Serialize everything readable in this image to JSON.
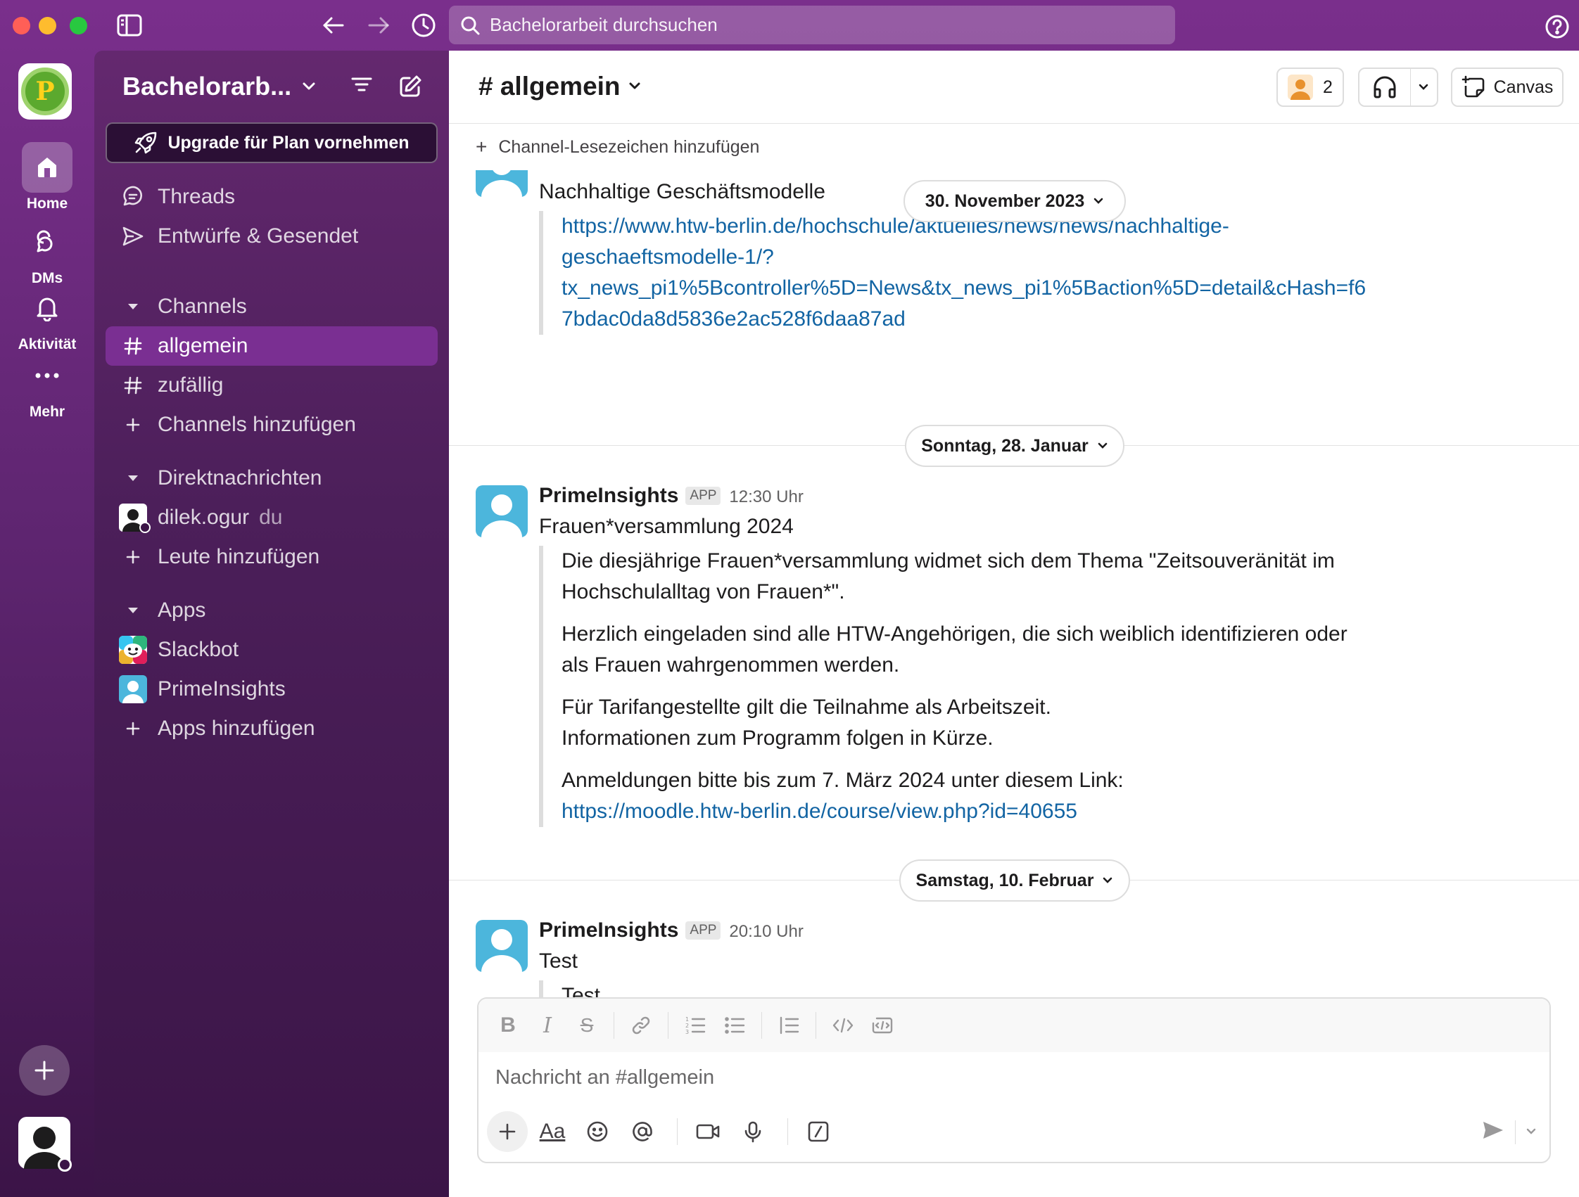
{
  "search": {
    "placeholder": "Bachelorarbeit durchsuchen"
  },
  "rail": {
    "workspace_initial": "P",
    "items": [
      {
        "label": "Home"
      },
      {
        "label": "DMs"
      },
      {
        "label": "Aktivität"
      },
      {
        "label": "Mehr"
      }
    ]
  },
  "sidebar": {
    "workspace_name": "Bachelorarb...",
    "upgrade_label": "Upgrade für Plan vornehmen",
    "nav": [
      {
        "label": "Threads"
      },
      {
        "label": "Entwürfe & Gesendet"
      }
    ],
    "channels_header": "Channels",
    "channels": [
      {
        "label": "allgemein"
      },
      {
        "label": "zufällig"
      }
    ],
    "add_channels": "Channels hinzufügen",
    "dm_header": "Direktnachrichten",
    "dm_user": "dilek.ogur",
    "dm_you": "du",
    "add_people": "Leute hinzufügen",
    "apps_header": "Apps",
    "apps": [
      {
        "label": "Slackbot"
      },
      {
        "label": "PrimeInsights"
      }
    ],
    "add_apps": "Apps hinzufügen"
  },
  "channel": {
    "title": "# allgemein",
    "member_count": "2",
    "canvas_label": "Canvas",
    "bookmark_label": "Channel-Lesezeichen hinzufügen"
  },
  "messages": {
    "msg1": {
      "title": "Nachhaltige Geschäftsmodelle",
      "link_lines": [
        "https://www.htw-berlin.de/hochschule/aktuelles/news/news/nachhaltige-",
        "geschaeftsmodelle-1/?",
        "tx_news_pi1%5Bcontroller%5D=News&tx_news_pi1%5Baction%5D=detail&cHash=f6",
        "7bdac0da8d5836e2ac528f6daa87ad"
      ]
    },
    "date1": "30. November 2023",
    "date2": "Sonntag, 28. Januar",
    "msg2": {
      "author": "PrimeInsights",
      "badge": "APP",
      "time": "12:30 Uhr",
      "title": "Frauen*versammlung 2024",
      "p1a": "Die diesjährige Frauen*versammlung widmet sich dem Thema \"Zeitsouveränität im",
      "p1b": "Hochschulalltag von Frauen*\".",
      "p2a": "Herzlich eingeladen sind alle HTW-Angehörigen, die sich weiblich identifizieren oder",
      "p2b": "als Frauen wahrgenommen werden.",
      "p3a": "Für Tarifangestellte gilt die Teilnahme als Arbeitszeit.",
      "p3b": "Informationen zum Programm folgen in Kürze.",
      "p4a": "Anmeldungen bitte bis zum 7. März 2024 unter diesem Link:",
      "p4_link": "https://moodle.htw-berlin.de/course/view.php?id=40655"
    },
    "date3": "Samstag, 10. Februar",
    "msg3": {
      "author": "PrimeInsights",
      "badge": "APP",
      "time": "20:10 Uhr",
      "title": "Test",
      "quote": "Test"
    }
  },
  "composer": {
    "placeholder": "Nachricht an #allgemein",
    "font_label": "Aa"
  },
  "colors": {
    "workspace_bg": "#5e2570",
    "sidebar_active": "#7a2f92",
    "link": "#1264a3"
  }
}
